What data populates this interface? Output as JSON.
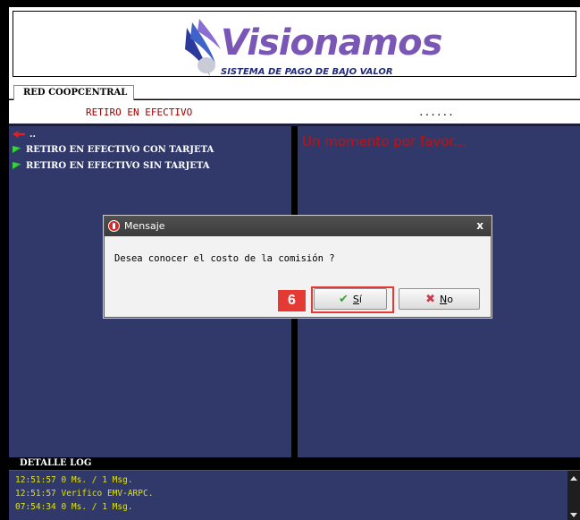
{
  "header": {
    "logo_text": "Visionamos",
    "logo_subtitle": "SISTEMA DE PAGO DE BAJO VALOR"
  },
  "tabs": [
    {
      "label": "RED COOPCENTRAL",
      "selected": true
    }
  ],
  "title_row": {
    "title": "RETIRO EN EFECTIVO",
    "dots": "......"
  },
  "menu": {
    "back_label": "..",
    "items": [
      {
        "label": "RETIRO EN EFECTIVO CON TARJETA",
        "icon": "green-flag-icon"
      },
      {
        "label": "RETIRO EN EFECTIVO SIN TARJETA",
        "icon": "green-flag-icon"
      }
    ]
  },
  "status": {
    "wait_message": "Un momento por favor..."
  },
  "dialog": {
    "title": "Mensaje",
    "close_label": "x",
    "message": "Desea conocer el costo de la comisión ?",
    "yes_glyph": "✔",
    "yes_prefix": "",
    "yes_mnemonic": "S",
    "yes_rest": "í",
    "no_glyph": "✖",
    "no_mnemonic": "N",
    "no_rest": "o"
  },
  "annotation": {
    "step_number": "6"
  },
  "log": {
    "title": "DETALLE LOG",
    "lines": [
      "12:51:57 0 Ms. / 1 Msg.",
      "12:51:57 Verifico EMV-ARPC.",
      "07:54:34 0 Ms. / 1 Msg."
    ]
  },
  "colors": {
    "panel_bg": "#31396a",
    "title_red": "#a00000",
    "log_yellow": "#e0e400",
    "annotation_red": "#e53934",
    "logo_purple": "#7a56b7"
  }
}
